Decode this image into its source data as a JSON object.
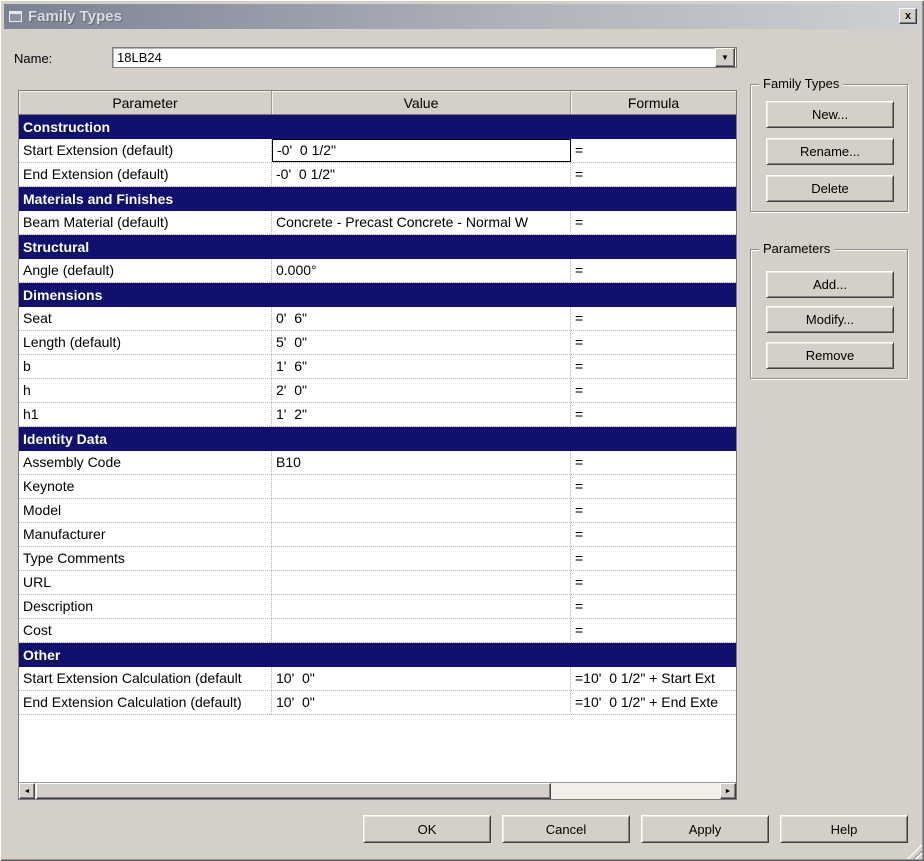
{
  "window": {
    "title": "Family Types"
  },
  "icons": {
    "close": "x",
    "dropdown": "▼",
    "scroll_left": "◄",
    "scroll_right": "►"
  },
  "colors": {
    "section_header_bg": "#10106e",
    "titlebar_left": "#7a8294",
    "titlebar_right": "#cdd0d4",
    "dialog_bg": "#d4d0c8"
  },
  "name_field": {
    "label": "Name:",
    "value": "18LB24"
  },
  "table": {
    "columns": [
      "Parameter",
      "Value",
      "Formula"
    ],
    "rows": [
      {
        "type": "section",
        "label": "Construction"
      },
      {
        "type": "param",
        "name": "Start Extension (default)",
        "value": "-0'  0 1/2\"",
        "formula": "=",
        "focused": true
      },
      {
        "type": "param",
        "name": "End Extension (default)",
        "value": "-0'  0 1/2\"",
        "formula": "="
      },
      {
        "type": "section",
        "label": "Materials and Finishes"
      },
      {
        "type": "param",
        "name": "Beam Material (default)",
        "value": "Concrete - Precast Concrete - Normal W",
        "formula": "="
      },
      {
        "type": "section",
        "label": "Structural"
      },
      {
        "type": "param",
        "name": "Angle (default)",
        "value": "0.000°",
        "formula": "="
      },
      {
        "type": "section",
        "label": "Dimensions"
      },
      {
        "type": "param",
        "name": "Seat",
        "value": "0'  6\"",
        "formula": "="
      },
      {
        "type": "param",
        "name": "Length (default)",
        "value": "5'  0\"",
        "formula": "="
      },
      {
        "type": "param",
        "name": "b",
        "value": "1'  6\"",
        "formula": "="
      },
      {
        "type": "param",
        "name": "h",
        "value": "2'  0\"",
        "formula": "="
      },
      {
        "type": "param",
        "name": "h1",
        "value": "1'  2\"",
        "formula": "="
      },
      {
        "type": "section",
        "label": "Identity Data"
      },
      {
        "type": "param",
        "name": "Assembly Code",
        "value": "B10",
        "formula": "="
      },
      {
        "type": "param",
        "name": "Keynote",
        "value": "",
        "formula": "="
      },
      {
        "type": "param",
        "name": "Model",
        "value": "",
        "formula": "="
      },
      {
        "type": "param",
        "name": "Manufacturer",
        "value": "",
        "formula": "="
      },
      {
        "type": "param",
        "name": "Type Comments",
        "value": "",
        "formula": "="
      },
      {
        "type": "param",
        "name": "URL",
        "value": "",
        "formula": "="
      },
      {
        "type": "param",
        "name": "Description",
        "value": "",
        "formula": "="
      },
      {
        "type": "param",
        "name": "Cost",
        "value": "",
        "formula": "="
      },
      {
        "type": "section",
        "label": "Other"
      },
      {
        "type": "param",
        "name": "Start Extension Calculation (default",
        "value": "10'  0\"",
        "formula": "=10'  0 1/2\" + Start Ext"
      },
      {
        "type": "param",
        "name": "End Extension Calculation (default)",
        "value": "10'  0\"",
        "formula": "=10'  0 1/2\" + End Exte"
      }
    ]
  },
  "family_types_group": {
    "title": "Family Types",
    "buttons": [
      "New...",
      "Rename...",
      "Delete"
    ]
  },
  "parameters_group": {
    "title": "Parameters",
    "buttons": [
      "Add...",
      "Modify...",
      "Remove"
    ]
  },
  "footer_buttons": [
    "OK",
    "Cancel",
    "Apply",
    "Help"
  ]
}
